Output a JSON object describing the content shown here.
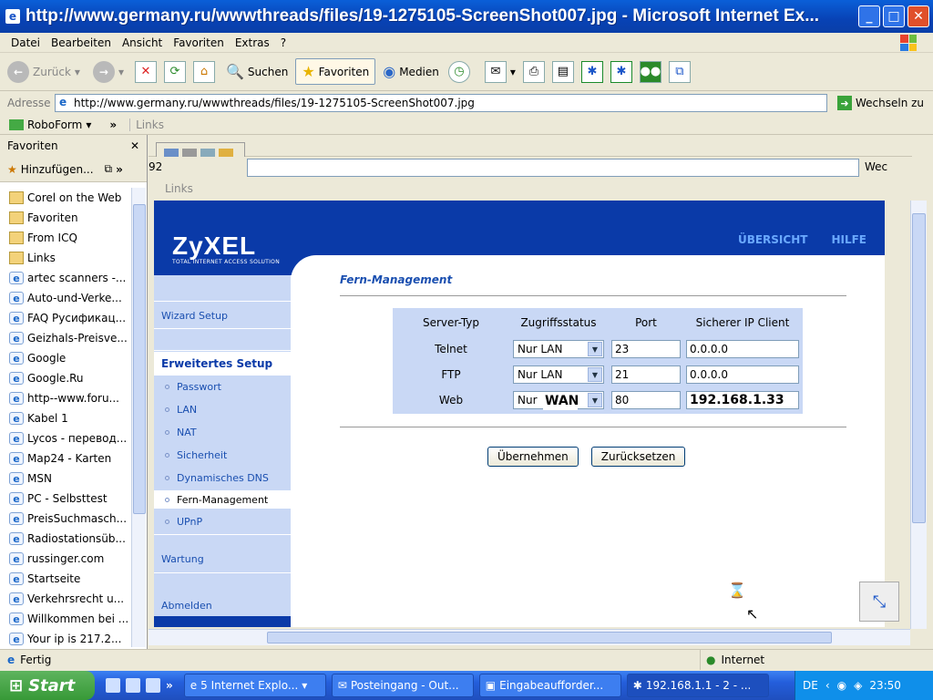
{
  "window": {
    "title": "http://www.germany.ru/wwwthreads/files/19-1275105-ScreenShot007.jpg - Microsoft Internet Ex..."
  },
  "menu": [
    "Datei",
    "Bearbeiten",
    "Ansicht",
    "Favoriten",
    "Extras",
    "?"
  ],
  "toolbar": {
    "back": "Zurück",
    "search": "Suchen",
    "favorites": "Favoriten",
    "media": "Medien"
  },
  "address": {
    "label": "Adresse",
    "url": "http://www.germany.ru/wwwthreads/files/19-1275105-ScreenShot007.jpg",
    "go": "Wechseln zu"
  },
  "linksbar": {
    "roboform": "RoboForm",
    "links": "Links"
  },
  "favorites": {
    "title": "Favoriten",
    "add": "Hinzufügen...",
    "items": [
      {
        "label": "Corel on the Web",
        "icon": "folder"
      },
      {
        "label": "Favoriten",
        "icon": "folder"
      },
      {
        "label": "From ICQ",
        "icon": "folder"
      },
      {
        "label": "Links",
        "icon": "folder"
      },
      {
        "label": "artec scanners -...",
        "icon": "link"
      },
      {
        "label": "Auto-und-Verke...",
        "icon": "link"
      },
      {
        "label": "FAQ Русификац...",
        "icon": "link"
      },
      {
        "label": "Geizhals-Preisve...",
        "icon": "link"
      },
      {
        "label": "Google",
        "icon": "link"
      },
      {
        "label": "Google.Ru",
        "icon": "link"
      },
      {
        "label": "http--www.foru...",
        "icon": "link"
      },
      {
        "label": "Kabel 1",
        "icon": "link"
      },
      {
        "label": "Lycos - перевод...",
        "icon": "link"
      },
      {
        "label": "Map24 - Karten",
        "icon": "link"
      },
      {
        "label": "MSN",
        "icon": "link"
      },
      {
        "label": "PC - Selbsttest",
        "icon": "link"
      },
      {
        "label": "PreisSuchmasch...",
        "icon": "link"
      },
      {
        "label": "Radiostationsüb...",
        "icon": "link"
      },
      {
        "label": "russinger.com",
        "icon": "link"
      },
      {
        "label": "Startseite",
        "icon": "link"
      },
      {
        "label": "Verkehrsrecht u...",
        "icon": "link"
      },
      {
        "label": "Willkommen bei ...",
        "icon": "link"
      },
      {
        "label": "Your ip is 217.2...",
        "icon": "link"
      }
    ]
  },
  "inner": {
    "links": "Links",
    "go_partial": "Wec",
    "url_partial": "92"
  },
  "router": {
    "brand": "ZyXEL",
    "tagline": "TOTAL INTERNET ACCESS SOLUTION",
    "nav": [
      "ÜBERSICHT",
      "HILFE"
    ],
    "leftnav": {
      "wizard": "Wizard Setup",
      "advanced": "Erweitertes Setup",
      "sub": [
        "Passwort",
        "LAN",
        "NAT",
        "Sicherheit",
        "Dynamisches DNS",
        "Fern-Management",
        "UPnP"
      ],
      "maintenance": "Wartung",
      "logout": "Abmelden"
    },
    "section_title": "Fern-Management",
    "table": {
      "headers": [
        "Server-Typ",
        "Zugriffsstatus",
        "Port",
        "Sicherer IP Client"
      ],
      "rows": [
        {
          "type": "Telnet",
          "access": "Nur LAN",
          "port": "23",
          "ip": "0.0.0.0"
        },
        {
          "type": "FTP",
          "access": "Nur LAN",
          "port": "21",
          "ip": "0.0.0.0"
        },
        {
          "type": "Web",
          "access": "Nur",
          "overlay": "WAN",
          "port": "80",
          "ip": "192.168.1.33"
        }
      ]
    },
    "buttons": {
      "apply": "Übernehmen",
      "reset": "Zurücksetzen"
    }
  },
  "status": {
    "text": "Fertig",
    "zone": "Internet"
  },
  "taskbar": {
    "start": "Start",
    "tasks": [
      "5 Internet Explo...",
      "Posteingang - Out...",
      "Eingabeaufforder...",
      "192.168.1.1 - 2 - ..."
    ],
    "lang": "DE",
    "clock": "23:50"
  }
}
